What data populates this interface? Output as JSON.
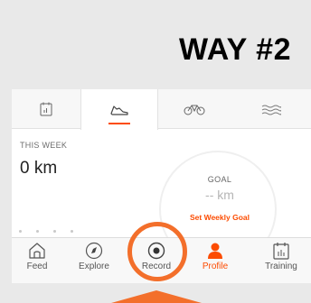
{
  "overlay": {
    "title": "WAY #2"
  },
  "tabs": [
    {
      "name": "tab-stats",
      "icon": "calendar-icon"
    },
    {
      "name": "tab-run",
      "icon": "shoe-icon",
      "active": true
    },
    {
      "name": "tab-ride",
      "icon": "bike-icon"
    },
    {
      "name": "tab-swim",
      "icon": "swim-icon"
    }
  ],
  "stats": {
    "week_label": "THIS WEEK",
    "week_value": "0 km",
    "goal_label": "GOAL",
    "goal_value": "-- km",
    "set_goal_link": "Set Weekly Goal"
  },
  "nav": {
    "feed": "Feed",
    "explore": "Explore",
    "record": "Record",
    "profile": "Profile",
    "training": "Training"
  },
  "colors": {
    "accent": "#fc4c02",
    "highlight": "#f36f2b"
  }
}
